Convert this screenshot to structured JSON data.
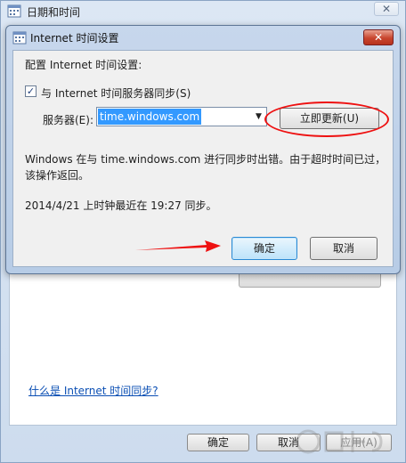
{
  "outer_window": {
    "title": "日期和时间",
    "close": "✕",
    "link": "什么是 Internet 时间同步?",
    "buttons": {
      "ok": "确定",
      "cancel": "取消",
      "apply": "应用(A)"
    }
  },
  "dialog": {
    "title": "Internet 时间设置",
    "close": "✕",
    "heading": "配置 Internet 时间设置:",
    "sync_checkbox": {
      "label": "与 Internet 时间服务器同步(S)",
      "checked": true,
      "mark": "✓"
    },
    "server": {
      "label": "服务器(E):",
      "value": "time.windows.com",
      "arrow": "▼"
    },
    "update_button": "立即更新(U)",
    "message": "Windows 在与 time.windows.com 进行同步时出错。由于超时时间已过，该操作返回。",
    "last_sync": "2014/4/21 上时钟最近在 19:27 同步。",
    "ok_button": "确定",
    "cancel_button": "取消"
  },
  "colors": {
    "annotation": "#e11111",
    "title_bar": "#c7d7ec",
    "close_button": "#c8452e",
    "link": "#0b4fb4"
  },
  "icons": {
    "window_icon": "calendar-clock-icon",
    "close": "close-icon",
    "dropdown": "chevron-down-icon"
  }
}
